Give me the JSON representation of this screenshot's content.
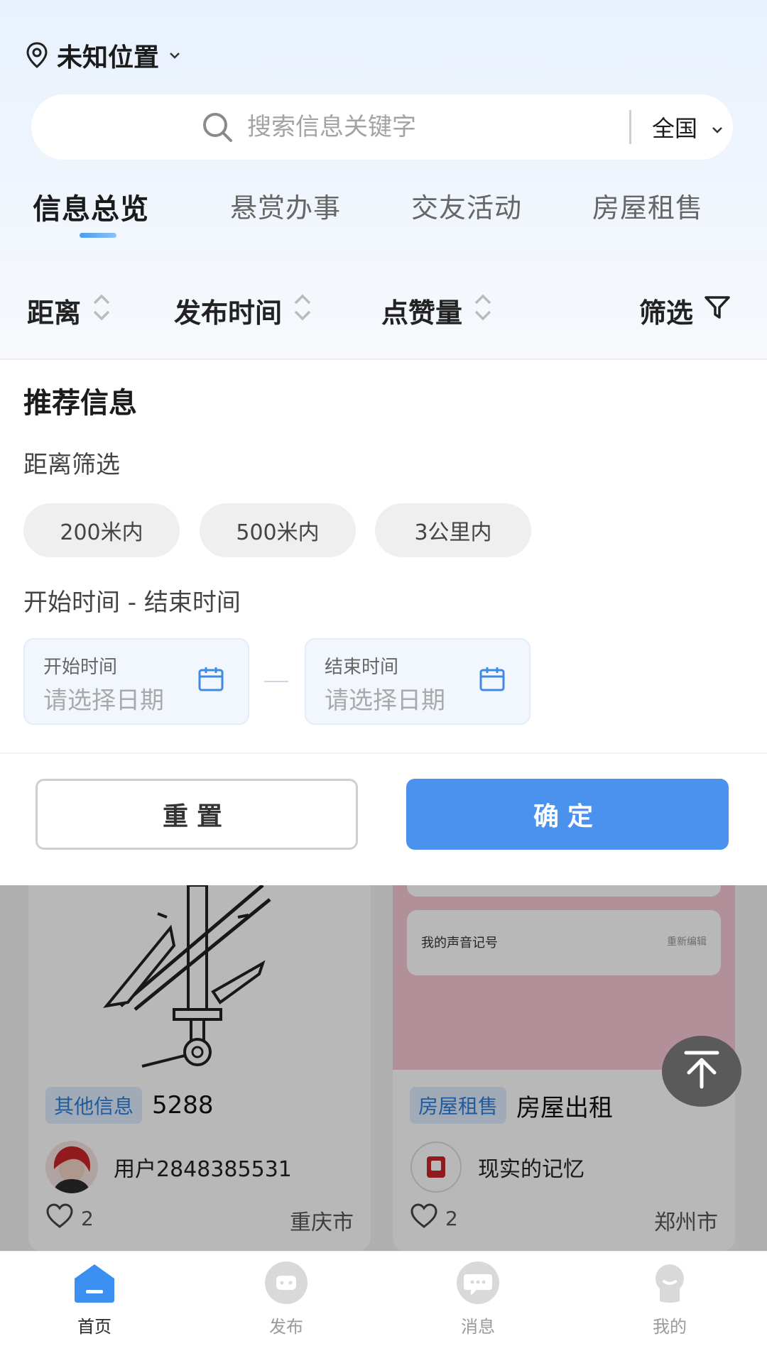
{
  "header": {
    "location": "未知位置",
    "search_placeholder": "搜索信息关键字",
    "region": "全国"
  },
  "tabs": [
    {
      "label": "信息总览",
      "active": true
    },
    {
      "label": "悬赏办事",
      "active": false
    },
    {
      "label": "交友活动",
      "active": false
    },
    {
      "label": "房屋租售",
      "active": false
    }
  ],
  "sort_bar": {
    "items": [
      "距离",
      "发布时间",
      "点赞量"
    ],
    "filter_label": "筛选"
  },
  "filter_panel": {
    "title": "推荐信息",
    "distance_label": "距离筛选",
    "distance_options": [
      "200米内",
      "500米内",
      "3公里内"
    ],
    "time_label": "开始时间 - 结束时间",
    "start": {
      "label": "开始时间",
      "placeholder": "请选择日期"
    },
    "end": {
      "label": "结束时间",
      "placeholder": "请选择日期"
    },
    "reset_label": "重置",
    "confirm_label": "确定",
    "confirm_color": "#4a92ee"
  },
  "feed": [
    {
      "tag": "其他信息",
      "title": "5288",
      "user": "用户2848385531",
      "likes": "2",
      "city": "重庆市"
    },
    {
      "tag": "房屋租售",
      "title": "房屋出租",
      "user": "现实的记忆",
      "likes": "2",
      "city": "郑州市",
      "record_title": "我的声音记号",
      "record_action": "重新编辑"
    }
  ],
  "bottom_nav": [
    {
      "label": "首页",
      "icon": "home-icon",
      "active": true
    },
    {
      "label": "发布",
      "icon": "publish-icon",
      "active": false
    },
    {
      "label": "消息",
      "icon": "message-icon",
      "active": false
    },
    {
      "label": "我的",
      "icon": "profile-icon",
      "active": false
    }
  ]
}
